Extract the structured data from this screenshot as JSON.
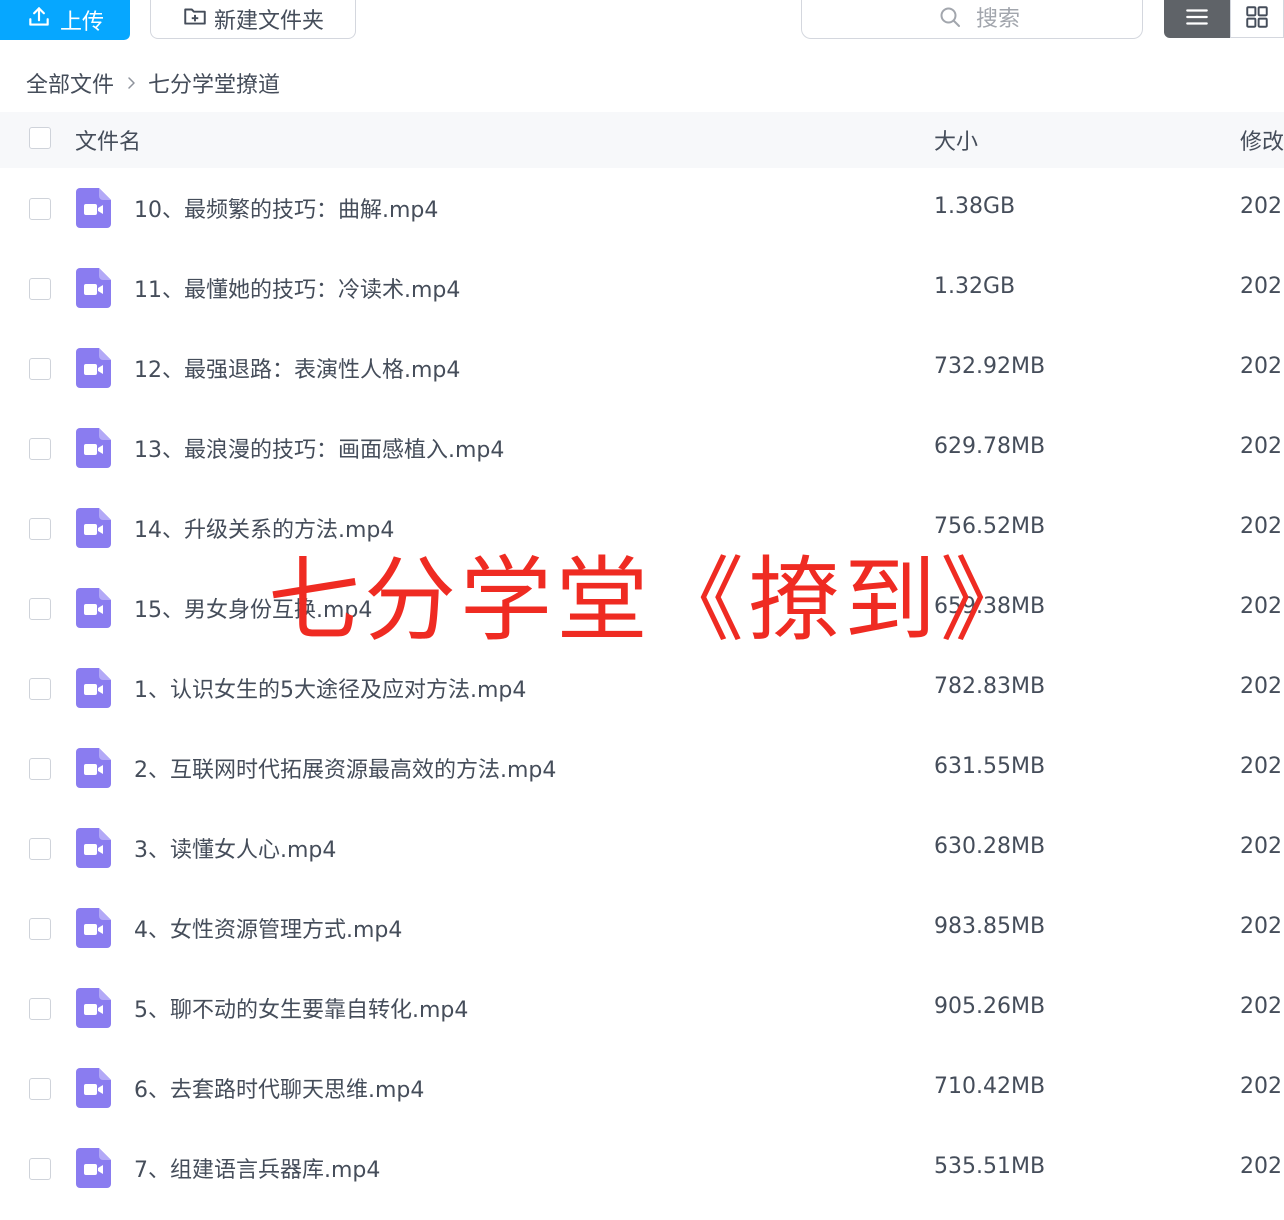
{
  "toolbar": {
    "upload_label": "上传",
    "new_folder_label": "新建文件夹",
    "search_placeholder": "搜索"
  },
  "breadcrumb": {
    "root": "全部文件",
    "current": "七分学堂撩道"
  },
  "table": {
    "col_name": "文件名",
    "col_size": "大小",
    "col_modified": "修改"
  },
  "files": [
    {
      "name": "10、最频繁的技巧：曲解.mp4",
      "size": "1.38GB",
      "date": "202"
    },
    {
      "name": "11、最懂她的技巧：冷读术.mp4",
      "size": "1.32GB",
      "date": "202"
    },
    {
      "name": "12、最强退路：表演性人格.mp4",
      "size": "732.92MB",
      "date": "202"
    },
    {
      "name": "13、最浪漫的技巧：画面感植入.mp4",
      "size": "629.78MB",
      "date": "202"
    },
    {
      "name": "14、升级关系的方法.mp4",
      "size": "756.52MB",
      "date": "202"
    },
    {
      "name": "15、男女身份互换.mp4",
      "size": "659.38MB",
      "date": "202"
    },
    {
      "name": "1、认识女生的5大途径及应对方法.mp4",
      "size": "782.83MB",
      "date": "202"
    },
    {
      "name": "2、互联网时代拓展资源最高效的方法.mp4",
      "size": "631.55MB",
      "date": "202"
    },
    {
      "name": "3、读懂女人心.mp4",
      "size": "630.28MB",
      "date": "202"
    },
    {
      "name": "4、女性资源管理方式.mp4",
      "size": "983.85MB",
      "date": "202"
    },
    {
      "name": "5、聊不动的女生要靠自转化.mp4",
      "size": "905.26MB",
      "date": "202"
    },
    {
      "name": "6、去套路时代聊天思维.mp4",
      "size": "710.42MB",
      "date": "202"
    },
    {
      "name": "7、组建语言兵器库.mp4",
      "size": "535.51MB",
      "date": "202"
    }
  ],
  "watermark": "七分学堂《撩到》",
  "colors": {
    "accent": "#06a7ff",
    "video_icon": "#8a7cf0",
    "watermark": "#ef2b22",
    "header_bg": "#f7f8fa"
  }
}
